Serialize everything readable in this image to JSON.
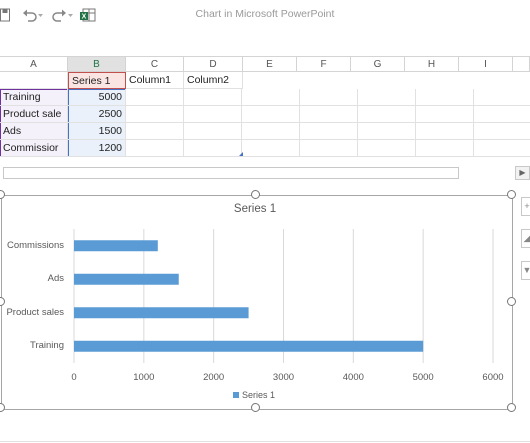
{
  "window": {
    "title": "Chart in Microsoft PowerPoint"
  },
  "toolbar": {
    "save_icon": "save-icon",
    "undo_icon": "undo-icon",
    "redo_icon": "redo-icon",
    "excel_icon": "excel-icon"
  },
  "sheet": {
    "columns": [
      "A",
      "B",
      "C",
      "D",
      "E",
      "F",
      "G",
      "H",
      "I"
    ],
    "header_row": [
      "",
      "Series 1",
      "Column1",
      "Column2"
    ],
    "rows": [
      [
        "Training",
        "5000"
      ],
      [
        "Product sale",
        "2500"
      ],
      [
        "Ads",
        "1500"
      ],
      [
        "Commissior",
        "1200"
      ]
    ]
  },
  "colors": {
    "bar": "#5b9bd5",
    "series_header_border": "#c0504d",
    "data_range_border": "#4472c4",
    "category_border": "#7030a0"
  },
  "chart_data": {
    "type": "bar",
    "orientation": "horizontal",
    "title": "Series 1",
    "categories": [
      "Training",
      "Product sales",
      "Ads",
      "Commissions"
    ],
    "series": [
      {
        "name": "Series 1",
        "values": [
          5000,
          2500,
          1500,
          1200
        ]
      }
    ],
    "xlim": [
      0,
      6000
    ],
    "ticks": [
      "0",
      "1000",
      "2000",
      "3000",
      "4000",
      "5000",
      "6000"
    ],
    "grid": true,
    "legend": "bottom"
  }
}
